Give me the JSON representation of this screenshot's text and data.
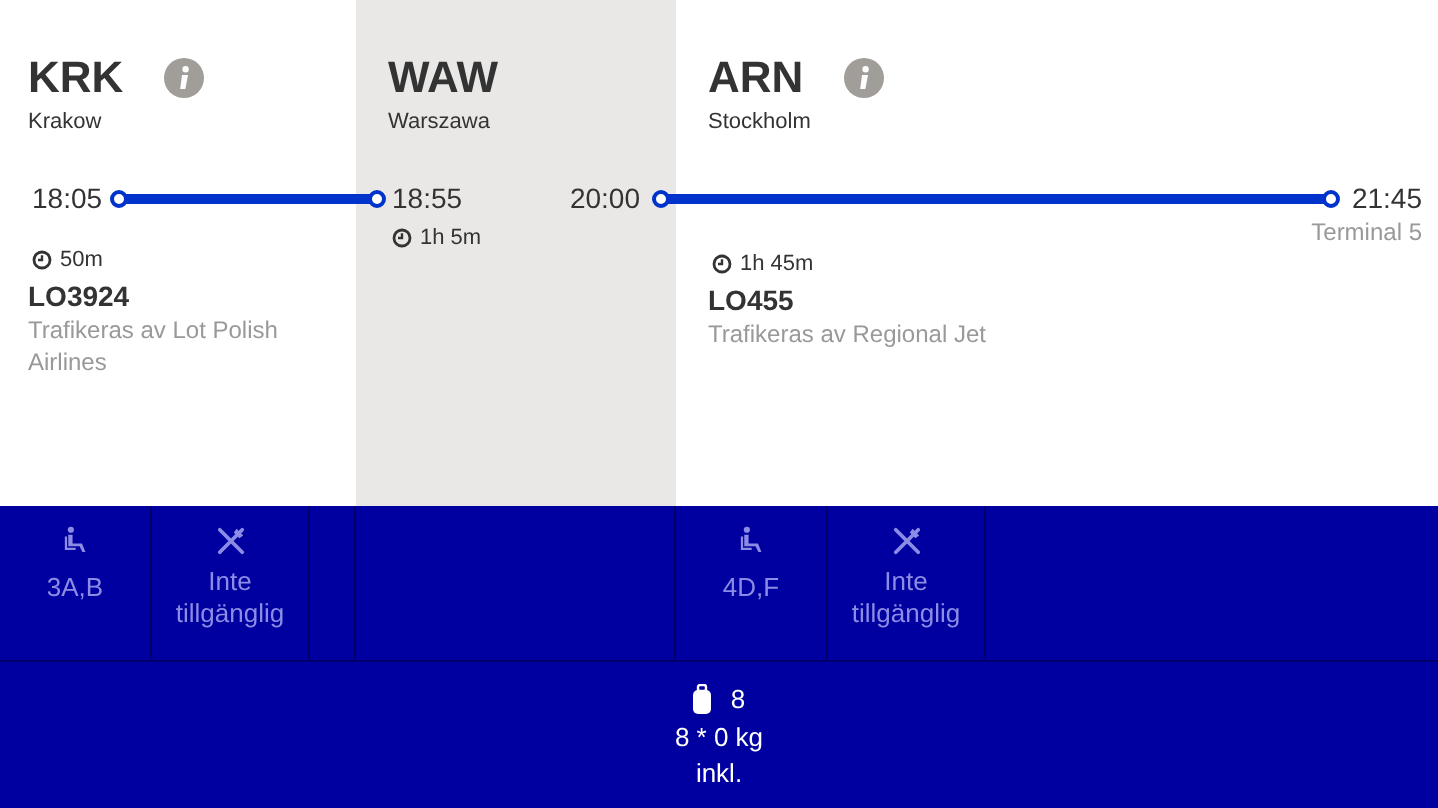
{
  "airports": [
    {
      "code": "KRK",
      "city": "Krakow",
      "info_icon": true
    },
    {
      "code": "WAW",
      "city": "Warszawa",
      "info_icon": false
    },
    {
      "code": "ARN",
      "city": "Stockholm",
      "info_icon": true
    }
  ],
  "flights": [
    {
      "departure": "18:05",
      "arrival": "18:55",
      "duration": "50m",
      "number": "LO3924",
      "operator": "Trafikeras av Lot Polish Airlines"
    },
    {
      "departure": "20:00",
      "arrival": "21:45",
      "arrival_terminal": "Terminal 5",
      "duration": "1h 45m",
      "number": "LO455",
      "operator": "Trafikeras av Regional Jet"
    }
  ],
  "stopover": {
    "duration": "1h 5m"
  },
  "services": [
    {
      "seat": "3A,B",
      "meal": "Inte tillgänglig"
    },
    {
      "seat": "4D,F",
      "meal": "Inte tillgänglig"
    }
  ],
  "baggage": {
    "count": "8",
    "weight": "8 * 0 kg",
    "status": "inkl."
  }
}
